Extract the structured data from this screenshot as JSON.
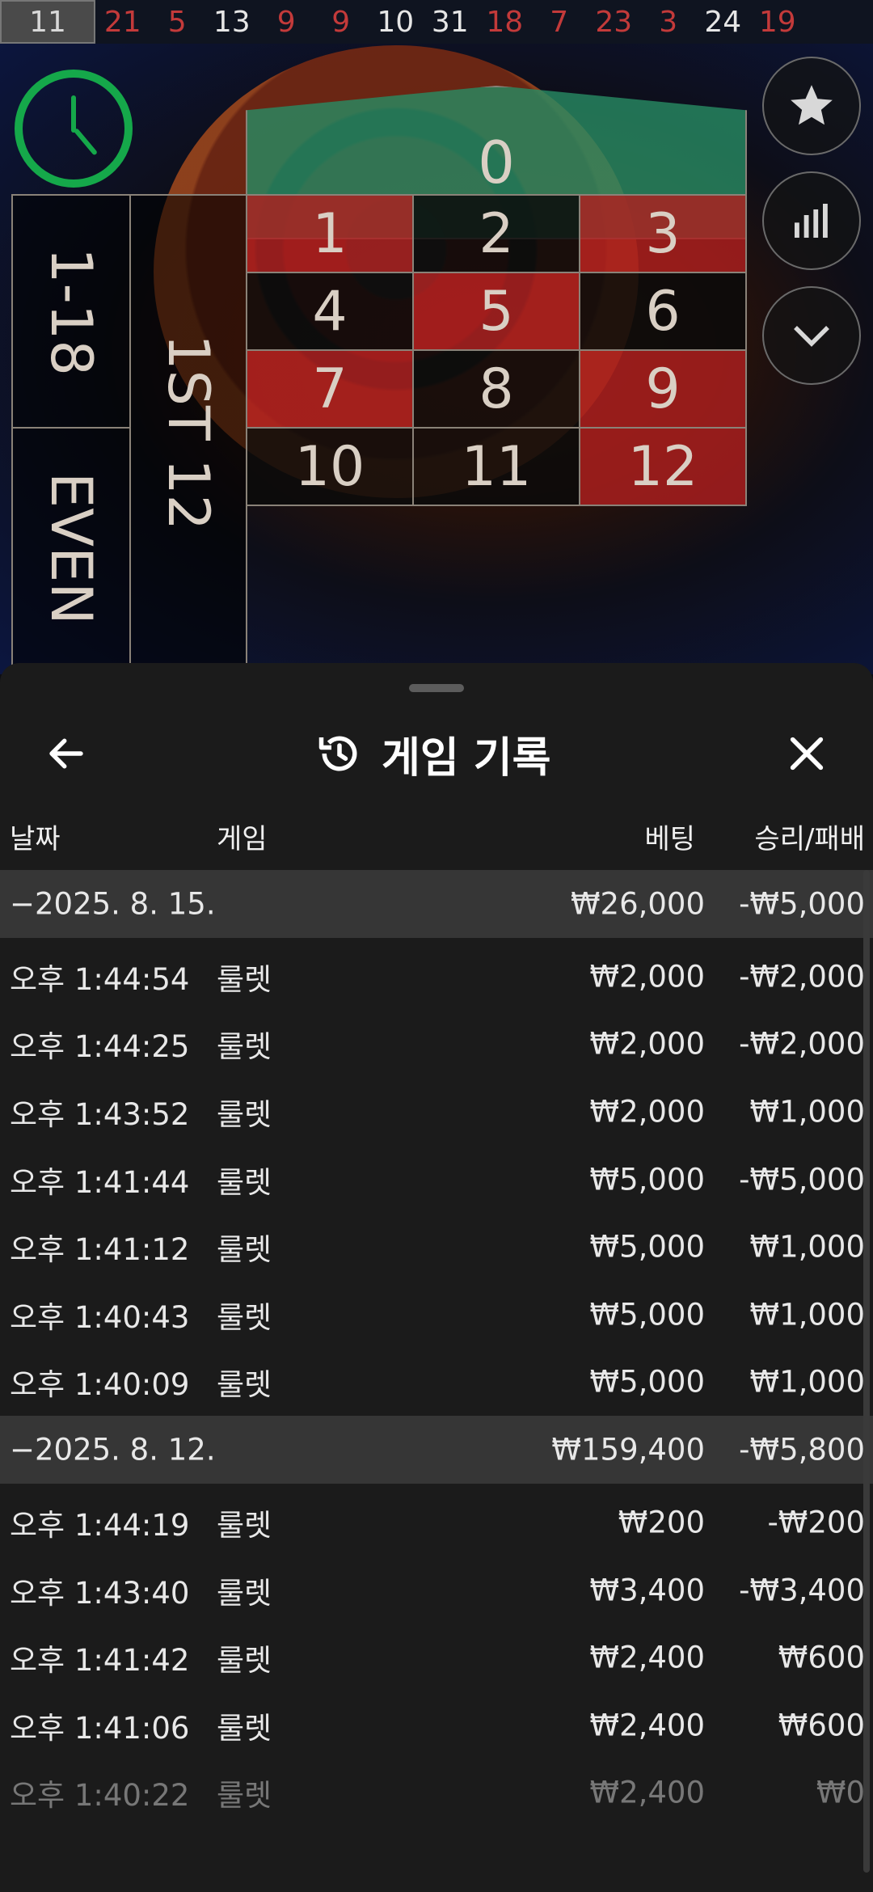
{
  "results_strip": [
    {
      "n": "11",
      "color": "current"
    },
    {
      "n": "21",
      "color": "red"
    },
    {
      "n": "5",
      "color": "red"
    },
    {
      "n": "13",
      "color": "black"
    },
    {
      "n": "9",
      "color": "red"
    },
    {
      "n": "9",
      "color": "red"
    },
    {
      "n": "10",
      "color": "black"
    },
    {
      "n": "31",
      "color": "black"
    },
    {
      "n": "18",
      "color": "red"
    },
    {
      "n": "7",
      "color": "red"
    },
    {
      "n": "23",
      "color": "red"
    },
    {
      "n": "3",
      "color": "red"
    },
    {
      "n": "24",
      "color": "black"
    },
    {
      "n": "19",
      "color": "red"
    }
  ],
  "table": {
    "zero": "0",
    "numbers": [
      "1",
      "2",
      "3",
      "4",
      "5",
      "6",
      "7",
      "8",
      "9",
      "10",
      "11",
      "12"
    ],
    "low": "1-18",
    "even": "EVEN",
    "dozen_first": "1ST 12"
  },
  "sheet": {
    "title": "게임 기록",
    "columns": {
      "date": "날짜",
      "game": "게임",
      "bet": "베팅",
      "result": "승리/패배"
    },
    "groups": [
      {
        "date": "−2025. 8. 15.",
        "bet": "₩26,000",
        "result": "-₩5,000",
        "rows": [
          {
            "time": "오후 1:44:54",
            "game": "룰렛",
            "bet": "₩2,000",
            "result": "-₩2,000"
          },
          {
            "time": "오후 1:44:25",
            "game": "룰렛",
            "bet": "₩2,000",
            "result": "-₩2,000"
          },
          {
            "time": "오후 1:43:52",
            "game": "룰렛",
            "bet": "₩2,000",
            "result": "₩1,000"
          },
          {
            "time": "오후 1:41:44",
            "game": "룰렛",
            "bet": "₩5,000",
            "result": "-₩5,000"
          },
          {
            "time": "오후 1:41:12",
            "game": "룰렛",
            "bet": "₩5,000",
            "result": "₩1,000"
          },
          {
            "time": "오후 1:40:43",
            "game": "룰렛",
            "bet": "₩5,000",
            "result": "₩1,000"
          },
          {
            "time": "오후 1:40:09",
            "game": "룰렛",
            "bet": "₩5,000",
            "result": "₩1,000"
          }
        ]
      },
      {
        "date": "−2025. 8. 12.",
        "bet": "₩159,400",
        "result": "-₩5,800",
        "rows": [
          {
            "time": "오후 1:44:19",
            "game": "룰렛",
            "bet": "₩200",
            "result": "-₩200"
          },
          {
            "time": "오후 1:43:40",
            "game": "룰렛",
            "bet": "₩3,400",
            "result": "-₩3,400"
          },
          {
            "time": "오후 1:41:42",
            "game": "룰렛",
            "bet": "₩2,400",
            "result": "₩600"
          },
          {
            "time": "오후 1:41:06",
            "game": "룰렛",
            "bet": "₩2,400",
            "result": "₩600"
          },
          {
            "time": "오후 1:40:22",
            "game": "룰렛",
            "bet": "₩2,400",
            "result": "₩0"
          }
        ]
      }
    ]
  },
  "colors": {
    "red": "#c33a3a",
    "timer": "#15a84a",
    "sheet_bg": "#1b1b1b",
    "date_row_bg": "#363636"
  },
  "icons": [
    "timer-icon",
    "star-icon",
    "statistics-icon",
    "chevron-down-icon",
    "back-arrow-icon",
    "history-icon",
    "close-icon"
  ]
}
